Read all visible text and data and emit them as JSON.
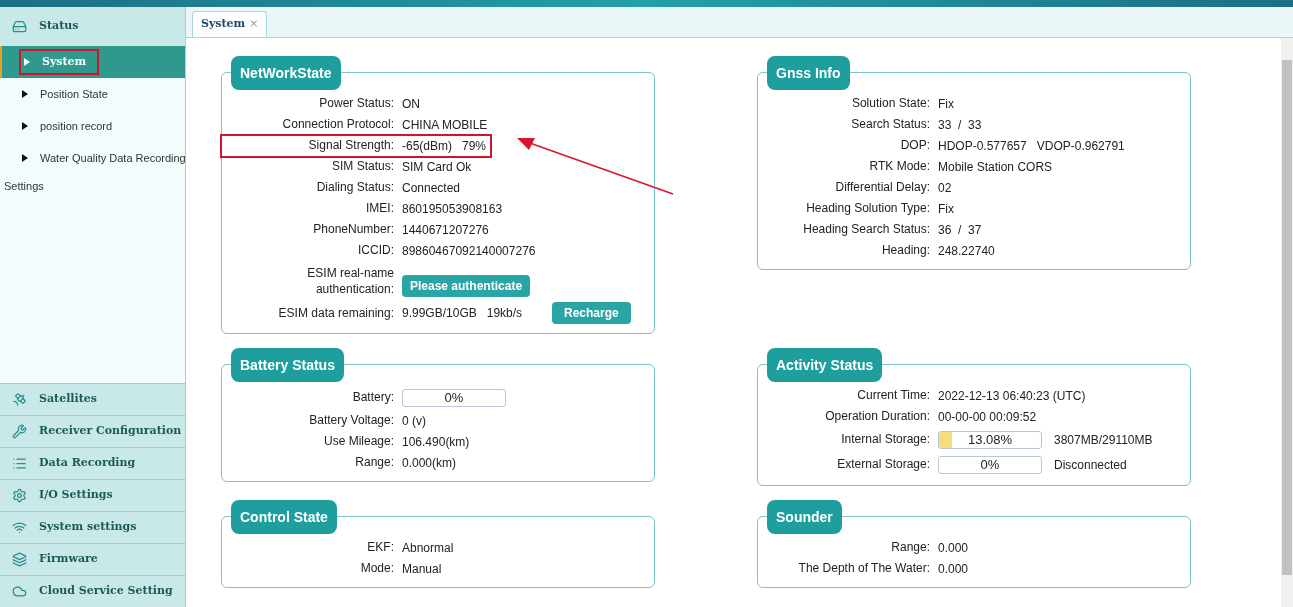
{
  "sidebar": {
    "header": {
      "label": "Status"
    },
    "items": [
      {
        "label": "System",
        "selected": true,
        "highlighted": true
      },
      {
        "label": "Position State",
        "selected": false,
        "highlighted": false
      },
      {
        "label": "position record",
        "selected": false,
        "highlighted": false
      },
      {
        "label": "Water Quality Data Recording",
        "selected": false,
        "highlighted": false
      }
    ],
    "settings_label": "Settings",
    "nav": [
      {
        "label": "Satellites"
      },
      {
        "label": "Receiver Configuration"
      },
      {
        "label": "Data Recording"
      },
      {
        "label": "I/O Settings"
      },
      {
        "label": "System settings"
      },
      {
        "label": "Firmware"
      },
      {
        "label": "Cloud Service Setting"
      }
    ]
  },
  "tabs": [
    {
      "label": "System",
      "close": "×",
      "selected": true
    }
  ],
  "panels": [
    {
      "title": "NetWorkState",
      "rows": [
        {
          "kind": "text",
          "label": "Power Status:",
          "value": "ON",
          "highlighted": false
        },
        {
          "kind": "text",
          "label": "Connection Protocol:",
          "value": "CHINA MOBILE",
          "highlighted": false
        },
        {
          "kind": "text",
          "label": "Signal Strength:",
          "value": "-65(dBm)   79%",
          "highlighted": true
        },
        {
          "kind": "text",
          "label": "SIM Status:",
          "value": "SIM Card Ok",
          "highlighted": false
        },
        {
          "kind": "text",
          "label": "Dialing Status:",
          "value": "Connected",
          "highlighted": false
        },
        {
          "kind": "text",
          "label": "IMEI:",
          "value": "860195053908163",
          "highlighted": false
        },
        {
          "kind": "text",
          "label": "PhoneNumber:",
          "value": "1440671207276",
          "highlighted": false
        },
        {
          "kind": "text",
          "label": "ICCID:",
          "value": "89860467092140007276",
          "highlighted": false
        },
        {
          "kind": "button",
          "label": "ESIM real-name authentication:",
          "button": "Please authenticate"
        },
        {
          "kind": "value_button",
          "label": "ESIM data remaining:",
          "value": "9.99GB/10GB   19kb/s",
          "button": "Recharge"
        }
      ]
    },
    {
      "title": "Gnss Info",
      "rows": [
        {
          "kind": "text",
          "label": "Solution State:",
          "value": "Fix",
          "highlighted": false
        },
        {
          "kind": "text",
          "label": "Search Status:",
          "value": "33  /  33",
          "highlighted": false
        },
        {
          "kind": "text",
          "label": "DOP:",
          "value": "HDOP-0.577657   VDOP-0.962791",
          "highlighted": false
        },
        {
          "kind": "text",
          "label": "RTK Mode:",
          "value": "Mobile Station CORS",
          "highlighted": false
        },
        {
          "kind": "text",
          "label": "Differential Delay:",
          "value": "02",
          "highlighted": false
        },
        {
          "kind": "text",
          "label": "Heading Solution Type:",
          "value": "Fix",
          "highlighted": false
        },
        {
          "kind": "text",
          "label": "Heading Search Status:",
          "value": "36  /  37",
          "highlighted": false
        },
        {
          "kind": "text",
          "label": "Heading:",
          "value": "248.22740",
          "highlighted": false
        }
      ]
    },
    {
      "title": "Battery Status",
      "rows": [
        {
          "kind": "bar",
          "label": "Battery:",
          "value": "0%",
          "level": 0
        },
        {
          "kind": "text",
          "label": "Battery Voltage:",
          "value": "0 (v)",
          "highlighted": false
        },
        {
          "kind": "text",
          "label": "Use Mileage:",
          "value": "106.490(km)",
          "highlighted": false
        },
        {
          "kind": "text",
          "label": "Range:",
          "value": "0.000(km)",
          "highlighted": false
        }
      ]
    },
    {
      "title": "Activity Status",
      "rows": [
        {
          "kind": "text",
          "label": "Current Time:",
          "value": "2022-12-13 06:40:23 (UTC)",
          "highlighted": false
        },
        {
          "kind": "text",
          "label": "Operation Duration:",
          "value": "00-00-00 00:09:52",
          "highlighted": false
        },
        {
          "kind": "bar",
          "label": "Internal Storage:",
          "value": "13.08%",
          "level": 0.1308,
          "note": "3807MB/29110MB"
        },
        {
          "kind": "bar",
          "label": "External Storage:",
          "value": "0%",
          "level": 0,
          "note": "Disconnected"
        }
      ]
    },
    {
      "title": "Control State",
      "rows": [
        {
          "kind": "text",
          "label": "EKF:",
          "value": "Abnormal",
          "highlighted": false
        },
        {
          "kind": "text",
          "label": "Mode:",
          "value": "Manual",
          "highlighted": false
        }
      ]
    },
    {
      "title": "Sounder",
      "rows": [
        {
          "kind": "text",
          "label": "Range:",
          "value": "0.000",
          "highlighted": false
        },
        {
          "kind": "text",
          "label": "The Depth of The Water:",
          "value": "0.000",
          "highlighted": false
        }
      ]
    }
  ]
}
